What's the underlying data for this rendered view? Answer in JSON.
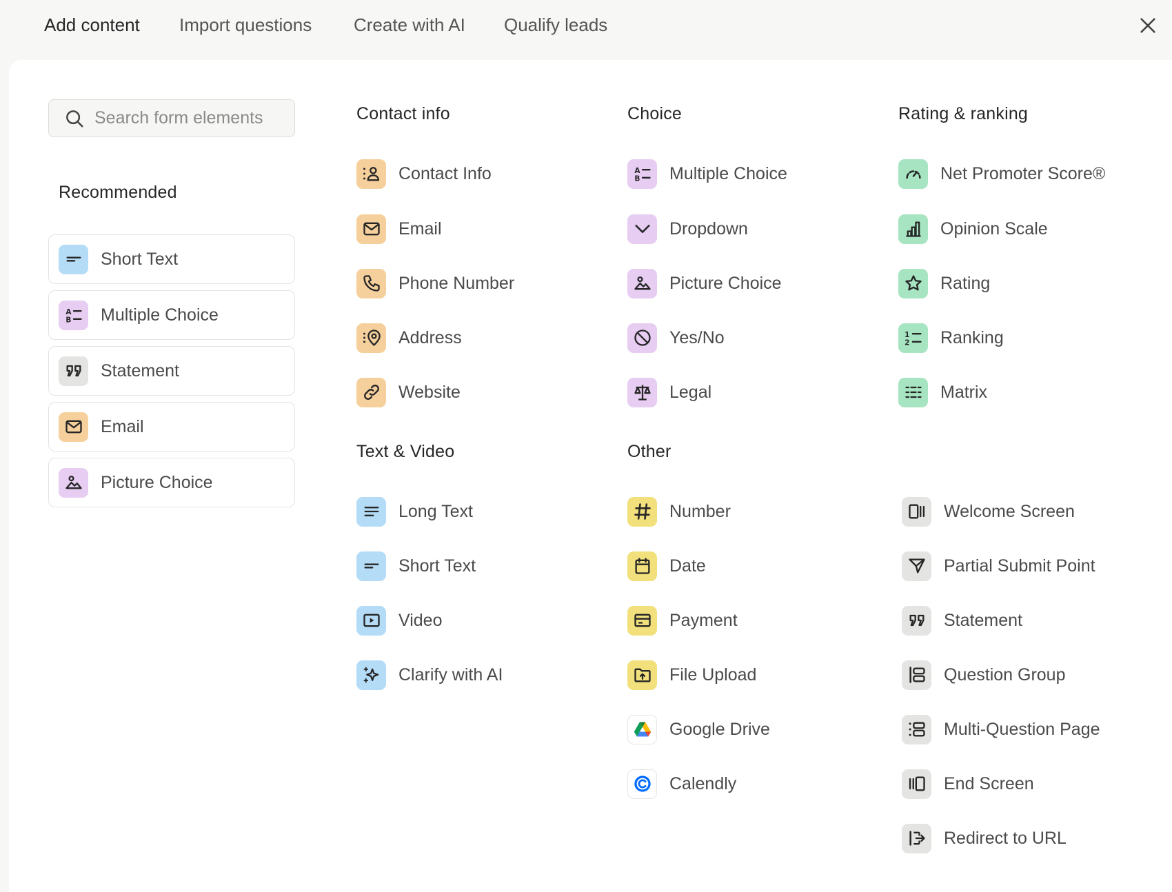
{
  "tabs": [
    {
      "label": "Add content"
    },
    {
      "label": "Import questions"
    },
    {
      "label": "Create with AI"
    },
    {
      "label": "Qualify leads"
    }
  ],
  "search": {
    "placeholder": "Search form elements"
  },
  "recommended": {
    "title": "Recommended",
    "items": [
      {
        "label": "Short Text",
        "icon": "short-text-icon",
        "color": "#b5dcf7"
      },
      {
        "label": "Multiple Choice",
        "icon": "multiple-choice-icon",
        "color": "#e7cdf2"
      },
      {
        "label": "Statement",
        "icon": "quote-icon",
        "color": "#e4e4e2"
      },
      {
        "label": "Email",
        "icon": "envelope-icon",
        "color": "#f6d09c"
      },
      {
        "label": "Picture Choice",
        "icon": "picture-icon",
        "color": "#e7cdf2"
      }
    ]
  },
  "sections": {
    "contact_info": {
      "title": "Contact info",
      "items": [
        {
          "label": "Contact Info",
          "icon": "contact-card-icon"
        },
        {
          "label": "Email",
          "icon": "envelope-icon"
        },
        {
          "label": "Phone Number",
          "icon": "phone-icon"
        },
        {
          "label": "Address",
          "icon": "location-pin-icon"
        },
        {
          "label": "Website",
          "icon": "link-icon"
        }
      ]
    },
    "choice": {
      "title": "Choice",
      "items": [
        {
          "label": "Multiple Choice",
          "icon": "multiple-choice-icon"
        },
        {
          "label": "Dropdown",
          "icon": "chevron-down-icon"
        },
        {
          "label": "Picture Choice",
          "icon": "picture-icon"
        },
        {
          "label": "Yes/No",
          "icon": "yes-no-icon"
        },
        {
          "label": "Legal",
          "icon": "scales-icon"
        }
      ]
    },
    "rating": {
      "title": "Rating & ranking",
      "items": [
        {
          "label": "Net Promoter Score®",
          "icon": "gauge-icon"
        },
        {
          "label": "Opinion Scale",
          "icon": "bar-chart-icon"
        },
        {
          "label": "Rating",
          "icon": "star-icon"
        },
        {
          "label": "Ranking",
          "icon": "numbered-list-icon"
        },
        {
          "label": "Matrix",
          "icon": "matrix-grid-icon"
        }
      ]
    },
    "text_video": {
      "title": "Text & Video",
      "items": [
        {
          "label": "Long Text",
          "icon": "long-text-icon"
        },
        {
          "label": "Short Text",
          "icon": "short-text-icon"
        },
        {
          "label": "Video",
          "icon": "video-play-icon"
        },
        {
          "label": "Clarify with AI",
          "icon": "sparkle-icon"
        }
      ]
    },
    "other": {
      "title": "Other",
      "items": [
        {
          "label": "Number",
          "icon": "hash-icon"
        },
        {
          "label": "Date",
          "icon": "calendar-icon"
        },
        {
          "label": "Payment",
          "icon": "credit-card-icon"
        },
        {
          "label": "File Upload",
          "icon": "folder-upload-icon"
        },
        {
          "label": "Google Drive",
          "icon": "google-drive-icon"
        },
        {
          "label": "Calendly",
          "icon": "calendly-icon"
        }
      ]
    },
    "screens": {
      "items": [
        {
          "label": "Welcome Screen",
          "icon": "welcome-screen-icon"
        },
        {
          "label": "Partial Submit Point",
          "icon": "send-icon"
        },
        {
          "label": "Statement",
          "icon": "quote-icon"
        },
        {
          "label": "Question Group",
          "icon": "question-group-icon"
        },
        {
          "label": "Multi-Question Page",
          "icon": "multi-question-icon"
        },
        {
          "label": "End Screen",
          "icon": "end-screen-icon"
        },
        {
          "label": "Redirect to URL",
          "icon": "redirect-icon"
        }
      ]
    }
  },
  "colors": {
    "contact": "#f6d09c",
    "choice": "#e7cdf2",
    "rating": "#a7e4c1",
    "text_video": "#b5dcf7",
    "other": "#f1e07b",
    "screens": "#e4e4e2",
    "background": "#f7f7f6",
    "panel": "#ffffff"
  }
}
